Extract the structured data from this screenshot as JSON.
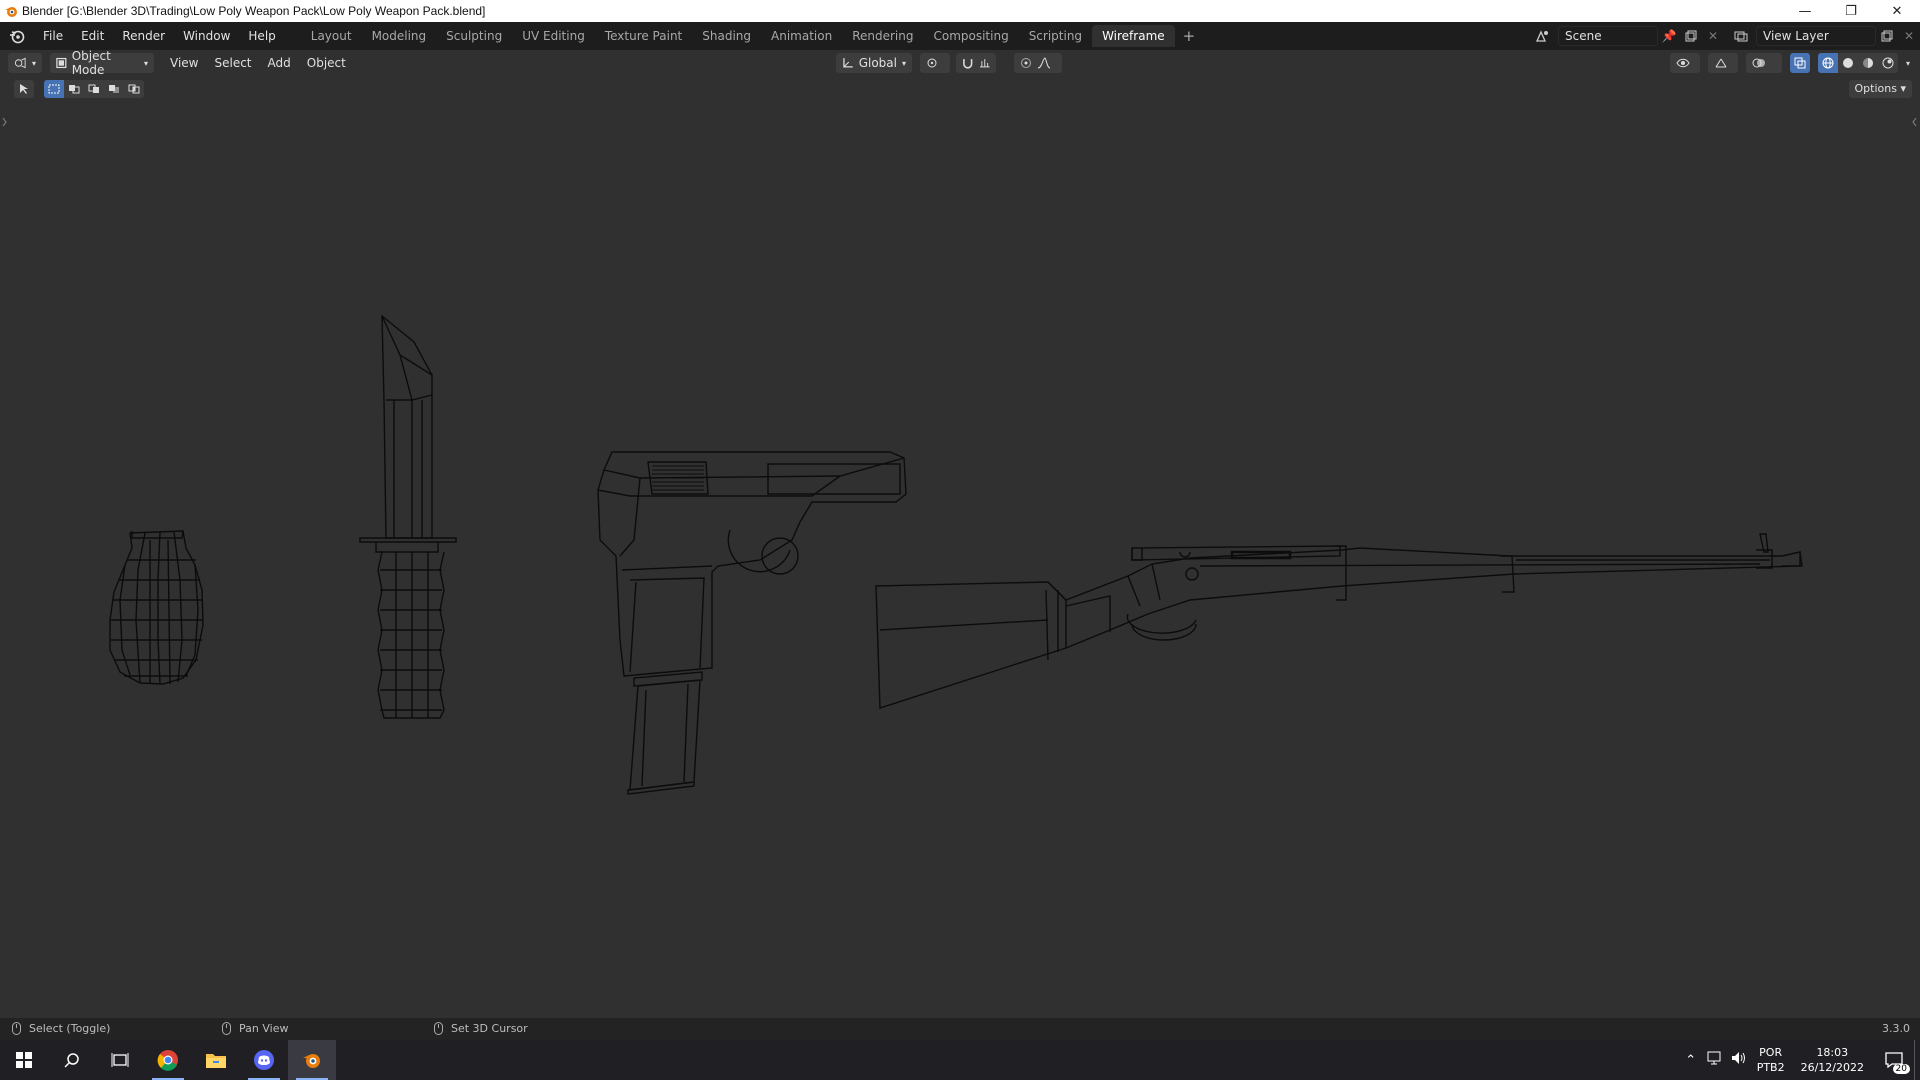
{
  "window": {
    "title": "Blender [G:\\Blender 3D\\Trading\\Low Poly Weapon Pack\\Low Poly Weapon Pack.blend]",
    "minimize": "—",
    "restore": "❐",
    "close": "✕"
  },
  "menubar": {
    "items": [
      "File",
      "Edit",
      "Render",
      "Window",
      "Help"
    ],
    "workspaces": [
      "Layout",
      "Modeling",
      "Sculpting",
      "UV Editing",
      "Texture Paint",
      "Shading",
      "Animation",
      "Rendering",
      "Compositing",
      "Scripting",
      "Wireframe"
    ],
    "active_workspace": "Wireframe",
    "add_workspace": "+",
    "scene": "Scene",
    "view_layer": "View Layer"
  },
  "viewport_header": {
    "mode": "Object Mode",
    "menus": [
      "View",
      "Select",
      "Add",
      "Object"
    ],
    "transform_orientation": "Global",
    "options": "Options"
  },
  "viewport": {
    "shading": "wireframe",
    "objects": [
      "grenade",
      "knife",
      "pistol",
      "rifle"
    ]
  },
  "statusbar": {
    "select": "Select (Toggle)",
    "pan": "Pan View",
    "cursor": "Set 3D Cursor",
    "version": "3.3.0"
  },
  "taskbar": {
    "lang_top": "POR",
    "lang_bottom": "PTB2",
    "time": "18:03",
    "date": "26/12/2022",
    "notifications": "20"
  },
  "colors": {
    "accent": "#4772b3",
    "viewport_bg": "#303030",
    "header_bg": "#1d1d1d",
    "wire": "#0a0a0a"
  }
}
